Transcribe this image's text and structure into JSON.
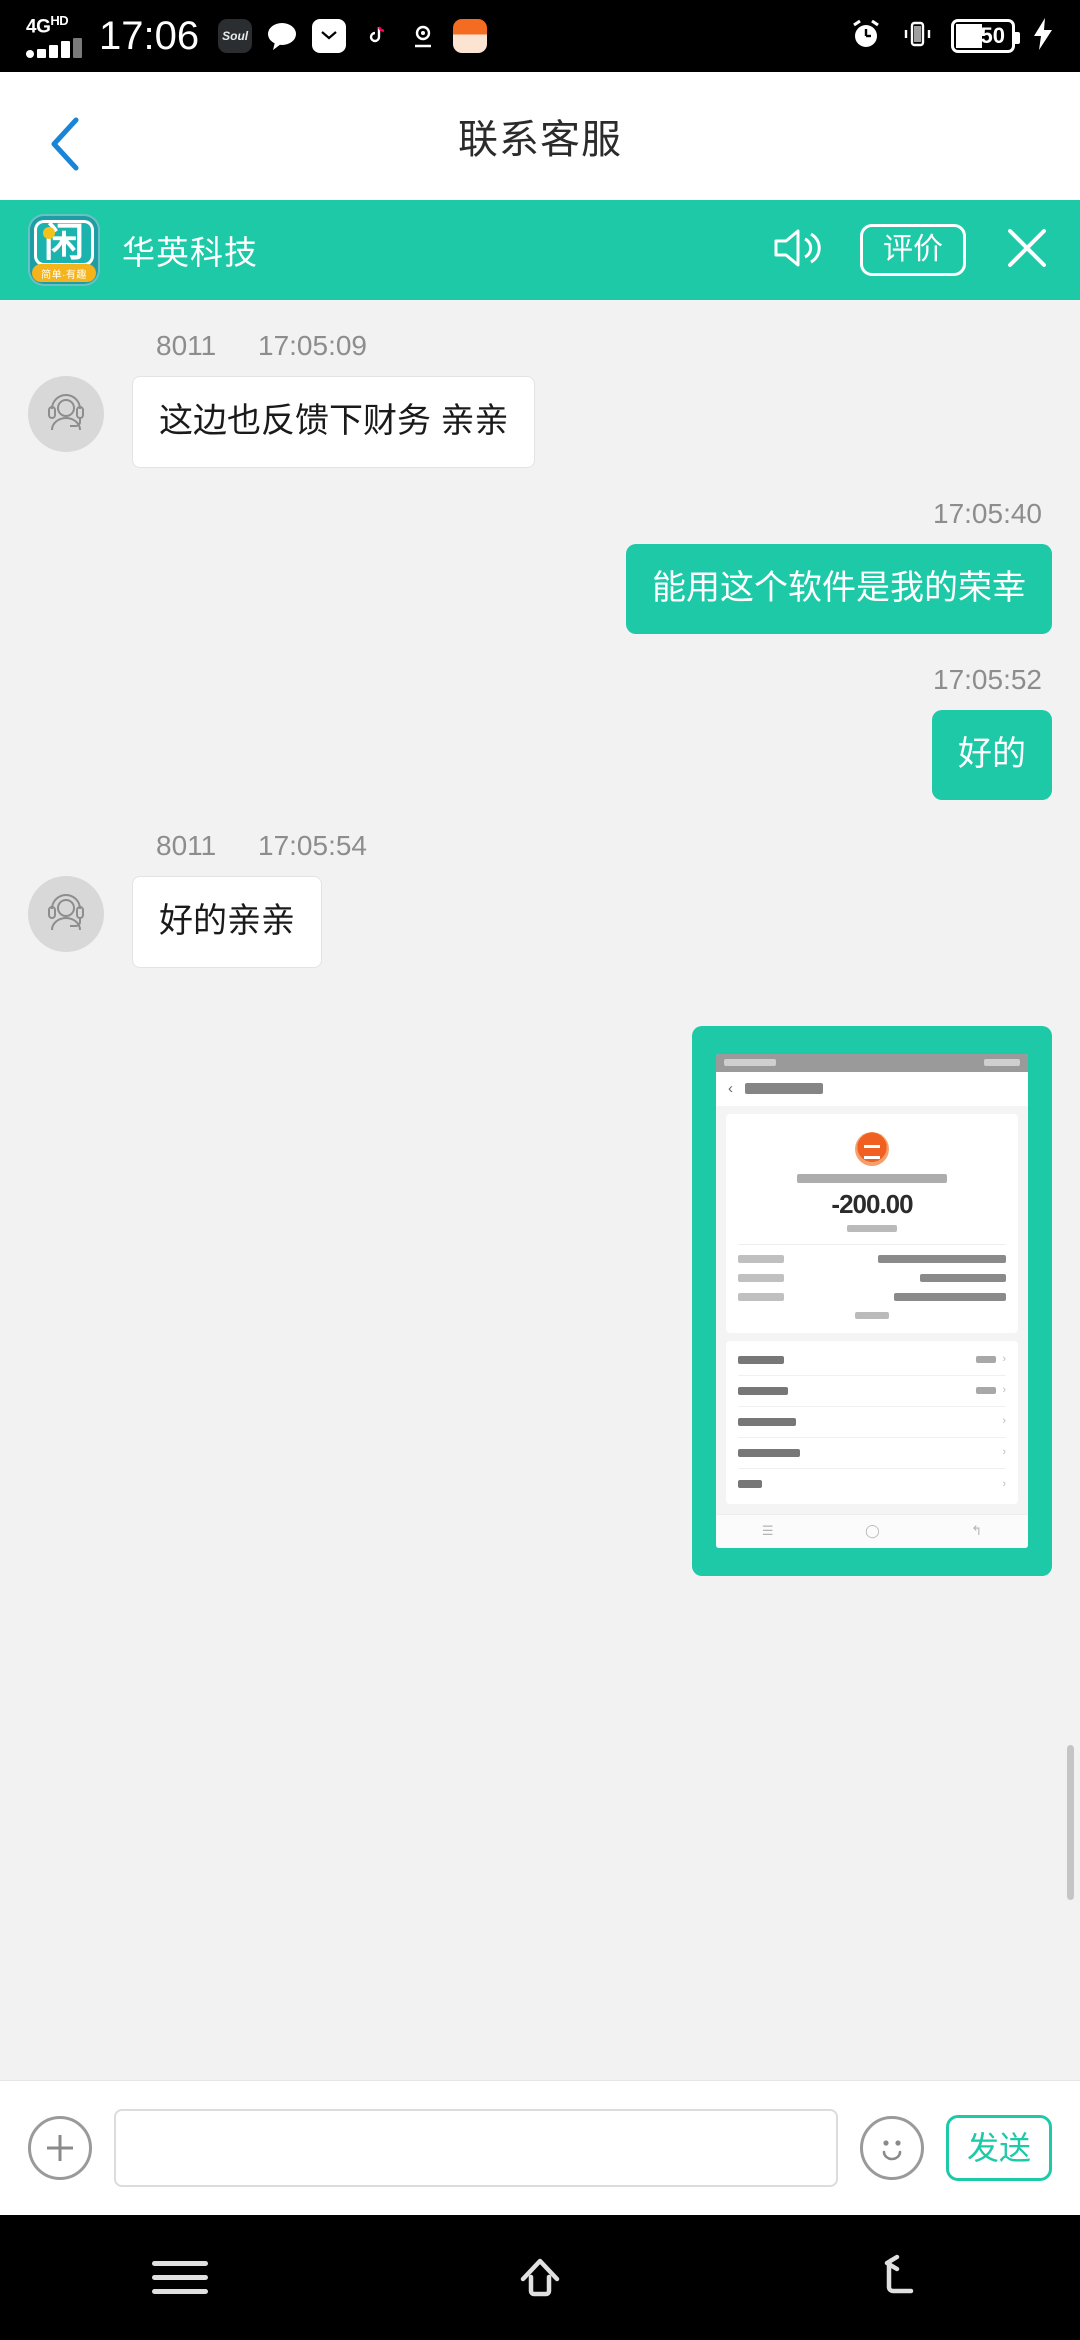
{
  "status_bar": {
    "network": "4G",
    "network_sup": "HD",
    "time": "17:06",
    "app_icons": [
      "soul-icon",
      "message-bubble-icon",
      "mail-icon",
      "tiktok-icon",
      "location-icon",
      "fox-app-icon"
    ],
    "soul_label": "Soul",
    "right_icons": [
      "alarm-icon",
      "vibrate-icon",
      "battery-icon",
      "charging-bolt-icon"
    ],
    "battery_level": "50"
  },
  "title_bar": {
    "back_icon": "back-chevron-icon",
    "title": "联系客服"
  },
  "brand_bar": {
    "logo_glyph": "闲",
    "logo_ribbon": "简单·有趣",
    "name": "华英科技",
    "speaker_icon": "speaker-icon",
    "rate_label": "评价",
    "close_icon": "close-icon",
    "background": "#1ec9a8"
  },
  "chat": {
    "messages": [
      {
        "direction": "in",
        "sender": "8011",
        "time": "17:05:09",
        "text": "这边也反馈下财务 亲亲",
        "avatar": "agent-headset-avatar"
      },
      {
        "direction": "out",
        "sender": "",
        "time": "17:05:40",
        "text": "能用这个软件是我的荣幸"
      },
      {
        "direction": "out",
        "sender": "",
        "time": "17:05:52",
        "text": "好的"
      },
      {
        "direction": "in",
        "sender": "8011",
        "time": "17:05:54",
        "text": "好的亲亲",
        "avatar": "agent-headset-avatar"
      }
    ],
    "attachment": {
      "type": "image",
      "description": "payment-detail-screenshot",
      "amount": "-200.00"
    }
  },
  "input_bar": {
    "add_icon": "plus-icon",
    "input_value": "",
    "input_placeholder": "",
    "emoji_icon": "emoji-smile-icon",
    "send_label": "发送",
    "accent": "#1ec9a8"
  },
  "nav_bar": {
    "items": [
      "menu-icon",
      "home-icon",
      "back-icon"
    ]
  }
}
